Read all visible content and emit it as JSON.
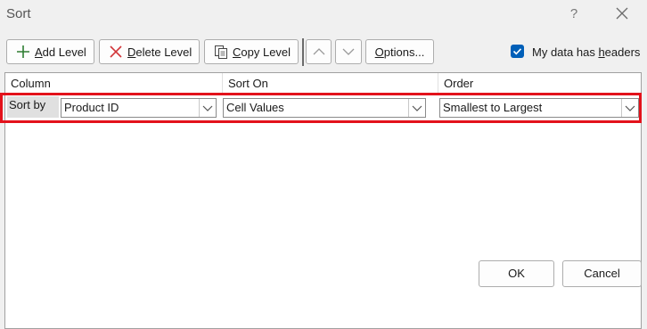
{
  "window": {
    "title": "Sort",
    "help_glyph": "?"
  },
  "toolbar": {
    "add_level": "Add Level",
    "delete_level": "Delete Level",
    "copy_level": "Copy Level",
    "options": "Options...",
    "move_up_icon": "chevron-up-icon",
    "move_down_icon": "chevron-down-icon"
  },
  "headers_checkbox": {
    "label": "My data has headers",
    "checked": true
  },
  "grid": {
    "columns": [
      "Column",
      "Sort On",
      "Order"
    ],
    "rows": [
      {
        "label": "Sort by",
        "column": "Product ID",
        "sort_on": "Cell Values",
        "order": "Smallest to Largest"
      }
    ]
  },
  "footer": {
    "ok": "OK",
    "cancel": "Cancel"
  },
  "colors": {
    "highlight": "#e3121b",
    "checkbox": "#005fb8",
    "add_icon": "#2e7d32",
    "delete_icon": "#d13438"
  }
}
